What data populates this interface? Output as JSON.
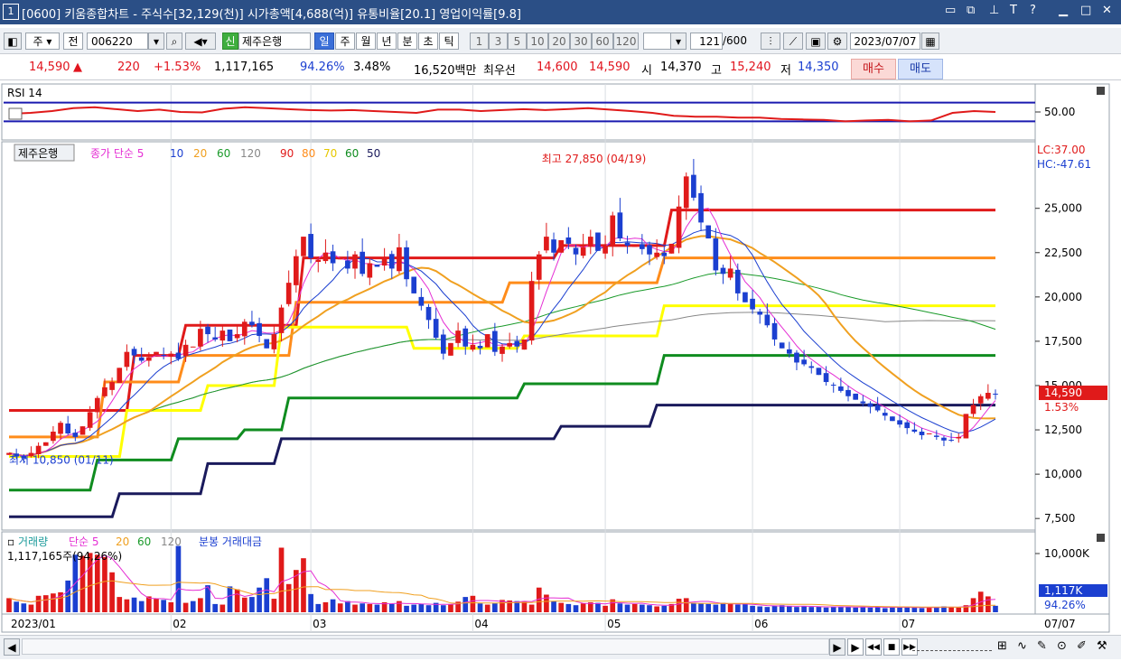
{
  "window": {
    "number": "1",
    "title": "[0600] 키움종합차트 - 주식수[32,129(천)] 시가총액[4,688(억)] 유통비율[20.1] 영업이익률[9.8]"
  },
  "toolbar": {
    "market": "주",
    "prev_label": "전",
    "code": "006220",
    "credit_badge": "신",
    "stock_name": "제주은행",
    "period_tabs": [
      "일",
      "주",
      "월",
      "년",
      "분",
      "초",
      "틱"
    ],
    "selected_tab": "일",
    "interval_buttons": [
      "1",
      "3",
      "5",
      "10",
      "20",
      "30",
      "60",
      "120"
    ],
    "count": "121",
    "count_total": "/600",
    "date": "2023/07/07"
  },
  "quote": {
    "price": "14,590",
    "change_arrow": "▲",
    "change": "220",
    "change_pct": "+1.53%",
    "volume": "1,117,165",
    "volume_ratio": "94.26%",
    "turnover": "3.48%",
    "amount": "16,520백만",
    "best_label": "최우선",
    "best_ask": "14,600",
    "best_bid": "14,590",
    "open_label": "시",
    "open": "14,370",
    "high_label": "고",
    "high": "15,240",
    "low_label": "저",
    "low": "14,350",
    "buy_label": "매수",
    "sell_label": "매도"
  },
  "chart_data": {
    "type": "candlestick",
    "rsi": {
      "title": "RSI 14",
      "level_label": "50.00",
      "upper_band": 70,
      "lower_band": 30,
      "values": [
        46,
        48,
        52,
        58,
        60,
        56,
        52,
        55,
        50,
        49,
        57,
        60,
        58,
        56,
        54,
        53,
        54,
        52,
        50,
        48,
        55,
        55,
        52,
        54,
        56,
        54,
        56,
        58,
        55,
        52,
        48,
        42,
        40,
        40,
        38,
        38,
        35,
        34,
        33,
        30,
        32,
        33,
        30,
        32,
        48,
        52,
        50
      ]
    },
    "price_legend": {
      "name": "제주은행",
      "ma_label": "종가 단순",
      "ma_periods": [
        "5",
        "10",
        "20",
        "60",
        "120"
      ],
      "levels": [
        "90",
        "80",
        "70",
        "60",
        "50"
      ]
    },
    "lc_label": "LC:37.00",
    "hc_label": "HC:-47.61",
    "max_annotation": "최고 27,850 (04/19)",
    "min_annotation": "최저 10,850 (01/11)",
    "current_price": "14,590",
    "current_change": "1.53%",
    "ylim": [
      7000,
      28500
    ],
    "yticks": [
      {
        "value": 25000,
        "label": "25,000"
      },
      {
        "value": 22500,
        "label": "22,500"
      },
      {
        "value": 20000,
        "label": "20,000"
      },
      {
        "value": 17500,
        "label": "17,500"
      },
      {
        "value": 15000,
        "label": "15,000"
      },
      {
        "value": 12500,
        "label": "12,500"
      },
      {
        "value": 10000,
        "label": "10,000"
      },
      {
        "value": 7500,
        "label": "7,500"
      }
    ],
    "x_labels": [
      {
        "index": 0,
        "label": "2023/01"
      },
      {
        "index": 22,
        "label": "02"
      },
      {
        "index": 41,
        "label": "03"
      },
      {
        "index": 63,
        "label": "04"
      },
      {
        "index": 81,
        "label": "05"
      },
      {
        "index": 101,
        "label": "06"
      },
      {
        "index": 121,
        "label": "07"
      }
    ],
    "x_end_label": "07/07",
    "closes": [
      11200,
      11000,
      10900,
      11200,
      11600,
      11800,
      12400,
      12900,
      12300,
      12100,
      12700,
      13500,
      14300,
      14900,
      15200,
      16000,
      16900,
      16700,
      16400,
      16600,
      16900,
      16700,
      16800,
      16500,
      17300,
      17200,
      18200,
      17900,
      17600,
      18100,
      17500,
      17900,
      18600,
      18400,
      17800,
      17100,
      17900,
      19400,
      20800,
      22300,
      23400,
      22200,
      22100,
      22500,
      21900,
      22200,
      21600,
      22400,
      21300,
      21900,
      21700,
      22200,
      21600,
      22800,
      21000,
      20200,
      19500,
      18700,
      17700,
      16800,
      17400,
      18100,
      17200,
      17300,
      17100,
      17900,
      16900,
      17200,
      17400,
      17200,
      17600,
      20900,
      22400,
      23400,
      22500,
      23200,
      23000,
      22400,
      22800,
      23400,
      22600,
      22900,
      24600,
      23300,
      22900,
      22900,
      22700,
      22400,
      22500,
      22300,
      23000,
      25100,
      26800,
      25600,
      24200,
      23300,
      21500,
      21300,
      21600,
      20200,
      19700,
      19300,
      19000,
      18400,
      17600,
      17100,
      16800,
      16300,
      16200,
      16000,
      15600,
      15200,
      15000,
      14700,
      14400,
      14200,
      14000,
      13800,
      13600,
      13300,
      13000,
      12800,
      12600,
      12400,
      12200,
      12300,
      12100,
      11900,
      11900,
      12100,
      13400,
      13900,
      14400,
      14590,
      14500
    ],
    "volume_legend": {
      "label": "거래량",
      "ma_label": "단순",
      "periods": [
        "5",
        "20",
        "60",
        "120"
      ],
      "extra": "분봉 거래대금",
      "value_text": "1,117,165주(94,26%)"
    },
    "volume_ticks": [
      {
        "value": 10000,
        "label": "10,000K"
      }
    ],
    "current_volume": "1,117K",
    "current_volume_ratio": "94.26%",
    "volumes": [
      2400,
      1800,
      1500,
      1300,
      2800,
      2900,
      3200,
      3400,
      5400,
      9800,
      9600,
      10100,
      9800,
      9400,
      6800,
      2600,
      2200,
      2500,
      1900,
      2700,
      2300,
      2100,
      1700,
      11300,
      1600,
      1900,
      2400,
      4600,
      1400,
      1300,
      4400,
      3900,
      2500,
      2600,
      4200,
      5800,
      2300,
      11000,
      4800,
      7200,
      9200,
      3100,
      1400,
      1700,
      2200,
      1500,
      1900,
      1300,
      1500,
      1400,
      1300,
      1700,
      1400,
      1900,
      1100,
      1300,
      1400,
      1200,
      1600,
      1200,
      1300,
      1800,
      2600,
      2800,
      1500,
      1300,
      1500,
      2100,
      2000,
      1900,
      1800,
      1300,
      4200,
      3000,
      1900,
      1600,
      1400,
      1200,
      1500,
      1700,
      1600,
      1100,
      2200,
      1500,
      1300,
      1400,
      1300,
      1200,
      1000,
      1100,
      1400,
      2300,
      2400,
      1600,
      1500,
      1400,
      1300,
      1600,
      1400,
      1300,
      1400,
      1100,
      1000,
      900,
      1100,
      1200,
      1000,
      900,
      1000,
      900,
      1000,
      800,
      900,
      1000,
      900,
      800,
      900,
      800,
      1000,
      700,
      800,
      900,
      900,
      800,
      700,
      800,
      900,
      1000,
      900,
      800,
      1200,
      2400,
      3500,
      2700,
      1100
    ],
    "bands": [
      {
        "label": "90",
        "color": "#e01a1a",
        "values": [
          [
            0,
            13600
          ],
          [
            17,
            16700
          ],
          [
            24,
            18400
          ],
          [
            40,
            22200
          ],
          [
            75,
            22900
          ],
          [
            90,
            24900
          ]
        ]
      },
      {
        "label": "80",
        "color": "#ff8c1a",
        "values": [
          [
            0,
            12100
          ],
          [
            13,
            15200
          ],
          [
            24,
            16700
          ],
          [
            39,
            19700
          ],
          [
            57,
            19700
          ],
          [
            68,
            20800
          ],
          [
            89,
            22200
          ]
        ]
      },
      {
        "label": "70",
        "color": "#ffff00",
        "values": [
          [
            0,
            11000
          ],
          [
            16,
            13600
          ],
          [
            27,
            15000
          ],
          [
            37,
            18300
          ],
          [
            55,
            17100
          ],
          [
            70,
            17800
          ],
          [
            89,
            19500
          ]
        ]
      },
      {
        "label": "60",
        "color": "#0f8c1f",
        "values": [
          [
            0,
            9100
          ],
          [
            12,
            10800
          ],
          [
            23,
            12000
          ],
          [
            32,
            12500
          ],
          [
            38,
            14300
          ],
          [
            70,
            15100
          ],
          [
            89,
            16700
          ]
        ]
      },
      {
        "label": "50",
        "color": "#1a1a5c",
        "values": [
          [
            0,
            7600
          ],
          [
            15,
            8900
          ],
          [
            27,
            10600
          ],
          [
            37,
            12000
          ],
          [
            75,
            12700
          ],
          [
            88,
            13900
          ]
        ]
      }
    ],
    "ma_colors": {
      "ma5": "#e52fd4",
      "ma10": "#1b3fd0",
      "ma20": "#f0a020",
      "ma60": "#1a9a2a",
      "ma120": "#888888"
    }
  },
  "bottom": {
    "left_arrow": "◀",
    "right_arrow": "▶",
    "nav_buttons": [
      "▶",
      "◀◀",
      "■",
      "▶▶"
    ]
  },
  "colors": {
    "up": "#e01a1a",
    "down": "#1b3fd0",
    "title_bg": "#2b4f86"
  }
}
